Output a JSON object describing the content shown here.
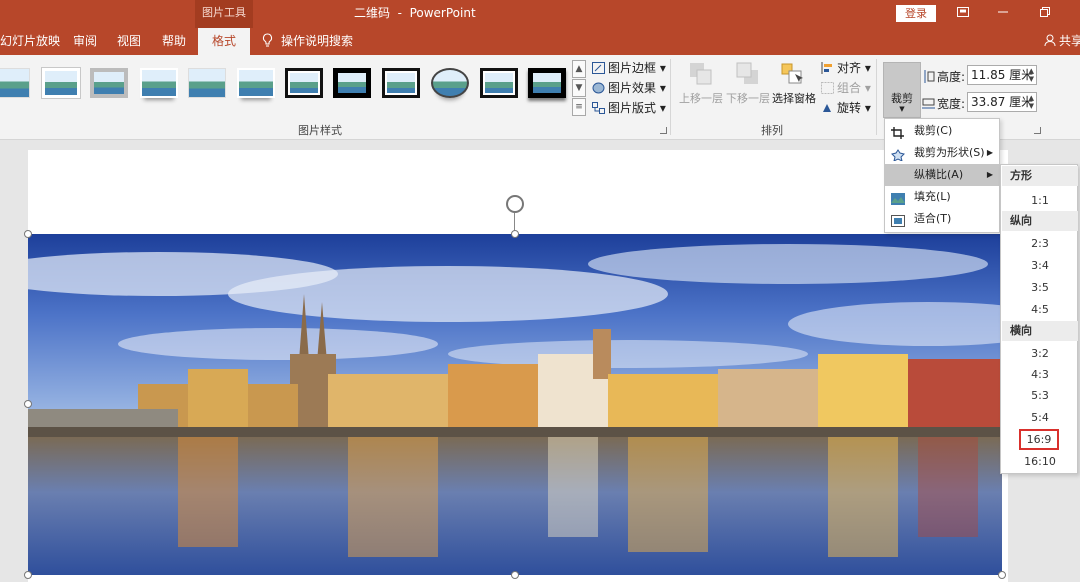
{
  "titlebar": {
    "context_tab": "图片工具",
    "doc_title": "二维码  -  PowerPoint",
    "login": "登录",
    "controls": [
      "restore-ribbon",
      "minimize",
      "maximize"
    ]
  },
  "tabs": [
    {
      "label": "幻灯片放映",
      "active": false
    },
    {
      "label": "审阅",
      "active": false
    },
    {
      "label": "视图",
      "active": false
    },
    {
      "label": "帮助",
      "active": false
    },
    {
      "label": "格式",
      "active": true
    }
  ],
  "tell_me": "操作说明搜索",
  "share": "共享",
  "ribbon": {
    "picture_styles": {
      "label": "图片样式",
      "thumbs": [
        "plain",
        "white-frame",
        "gray-frame",
        "soft-edge",
        "fade",
        "reflect",
        "black-frame",
        "thick-black",
        "black-white",
        "oval",
        "double-frame",
        "black-shadow"
      ],
      "border": "图片边框",
      "effects": "图片效果",
      "layout": "图片版式"
    },
    "arrange": {
      "label": "排列",
      "bring_forward": "上移一层",
      "send_backward": "下移一层",
      "selection_pane": "选择窗格",
      "align": "对齐",
      "group": "组合",
      "rotate": "旋转"
    },
    "size": {
      "crop": "裁剪",
      "height_label": "高度:",
      "height_value": "11.85 厘米",
      "width_label": "宽度:",
      "width_value": "33.87 厘米"
    }
  },
  "crop_menu": {
    "items": [
      {
        "label": "裁剪(C)",
        "icon": "crop-icon",
        "submenu": false
      },
      {
        "label": "裁剪为形状(S)",
        "icon": "shape-crop-icon",
        "submenu": true
      },
      {
        "label": "纵横比(A)",
        "icon": "",
        "submenu": true,
        "highlighted": true
      },
      {
        "label": "填充(L)",
        "icon": "fill-icon",
        "submenu": false
      },
      {
        "label": "适合(T)",
        "icon": "fit-icon",
        "submenu": false
      }
    ]
  },
  "aspect_menu": {
    "square_head": "方形",
    "square": [
      "1:1"
    ],
    "portrait_head": "纵向",
    "portrait": [
      "2:3",
      "3:4",
      "3:5",
      "4:5"
    ],
    "landscape_head": "横向",
    "landscape": [
      "3:2",
      "4:3",
      "5:3",
      "5:4",
      "16:9",
      "16:10"
    ],
    "selected": "16:9"
  },
  "colors": {
    "accent": "#b7472a",
    "ribbon_bg": "#f3f3f3",
    "highlight": "#c6c6c6",
    "selection_box": "#d9302c"
  }
}
